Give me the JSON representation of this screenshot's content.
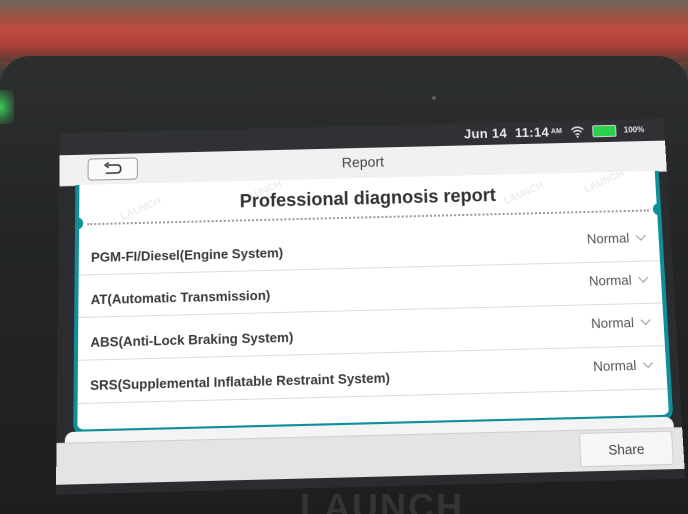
{
  "status_bar": {
    "date": "Jun 14",
    "time": "11:14",
    "ampm": "AM",
    "battery": "100%",
    "battery_color": "#2bd14e"
  },
  "header": {
    "back_icon": "back-arrow-icon",
    "title": "Report"
  },
  "report": {
    "heading": "Professional diagnosis report",
    "accent_color": "#0f8f9a",
    "systems": [
      {
        "name": "PGM-FI/Diesel(Engine System)",
        "status": "Normal"
      },
      {
        "name": "AT(Automatic Transmission)",
        "status": "Normal"
      },
      {
        "name": "ABS(Anti-Lock Braking System)",
        "status": "Normal"
      },
      {
        "name": "SRS(Supplemental Inflatable Restraint System)",
        "status": "Normal"
      }
    ],
    "watermark": "LAUNCH"
  },
  "footer": {
    "share_label": "Share"
  },
  "device": {
    "brand": "LAUNCH"
  }
}
